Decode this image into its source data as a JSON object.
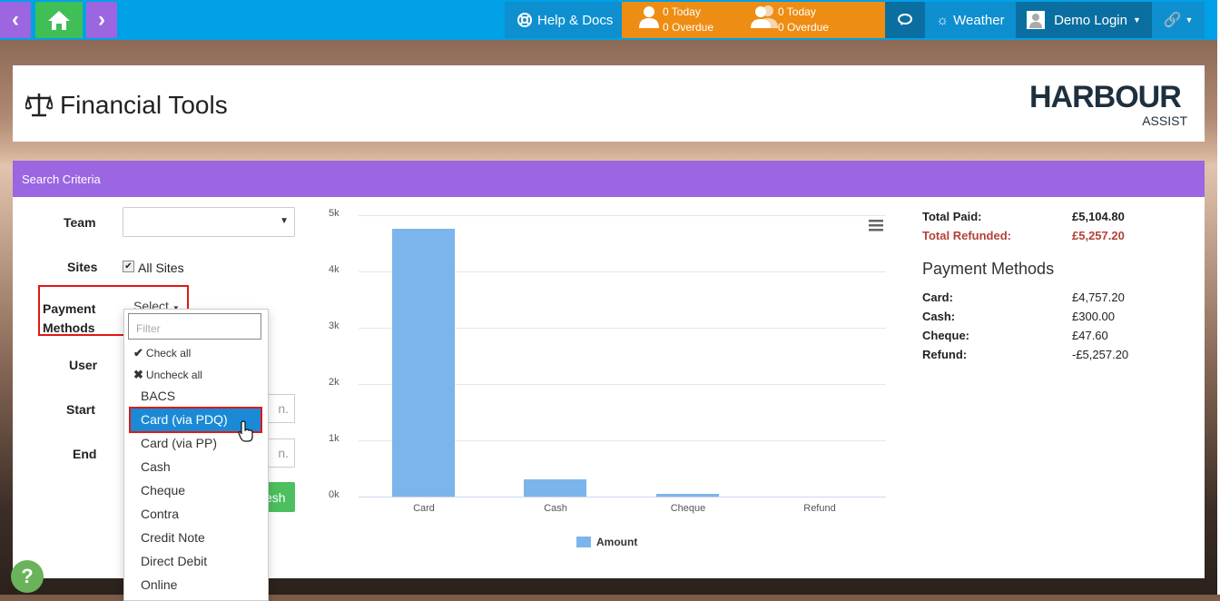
{
  "nav": {
    "help_docs": "Help & Docs",
    "tasks1_today": "0 Today",
    "tasks1_overdue": "0 Overdue",
    "tasks2_today": "0 Today",
    "tasks2_overdue": "0 Overdue",
    "weather": "Weather",
    "user": "Demo Login"
  },
  "header": {
    "title": "Financial Tools",
    "logo_main": "HARBOUR",
    "logo_sub": "ASSIST"
  },
  "panel": {
    "title": "Search Criteria"
  },
  "form": {
    "team_label": "Team",
    "sites_label": "Sites",
    "all_sites": "All Sites",
    "payment_label_1": "Payment",
    "payment_label_2": "Methods",
    "select_label": "Select",
    "user_label": "User",
    "start_label": "Start",
    "end_label": "End",
    "start_suffix": "n.",
    "end_suffix": "n.",
    "refresh_label": "esh"
  },
  "dropdown": {
    "filter_placeholder": "Filter",
    "check_all": "Check all",
    "uncheck_all": "Uncheck all",
    "items": [
      "BACS",
      "Card (via PDQ)",
      "Card (via PP)",
      "Cash",
      "Cheque",
      "Contra",
      "Credit Note",
      "Direct Debit",
      "Online"
    ]
  },
  "chart_data": {
    "type": "bar",
    "categories": [
      "Card",
      "Cash",
      "Cheque",
      "Refund"
    ],
    "series": [
      {
        "name": "Amount",
        "values": [
          4757.2,
          300,
          47.6,
          0
        ]
      }
    ],
    "ylim": [
      0,
      5000
    ],
    "yticks": [
      "0k",
      "1k",
      "2k",
      "3k",
      "4k",
      "5k"
    ],
    "legend": "bottom",
    "color": "#7cb5ec"
  },
  "summary": {
    "total_paid_label": "Total Paid:",
    "total_paid": "£5,104.80",
    "total_refunded_label": "Total Refunded:",
    "total_refunded": "£5,257.20",
    "methods_title": "Payment Methods",
    "rows": [
      {
        "label": "Card:",
        "value": "£4,757.20"
      },
      {
        "label": "Cash:",
        "value": "£300.00"
      },
      {
        "label": "Cheque:",
        "value": "£47.60"
      },
      {
        "label": "Refund:",
        "value": "-£5,257.20"
      }
    ]
  }
}
